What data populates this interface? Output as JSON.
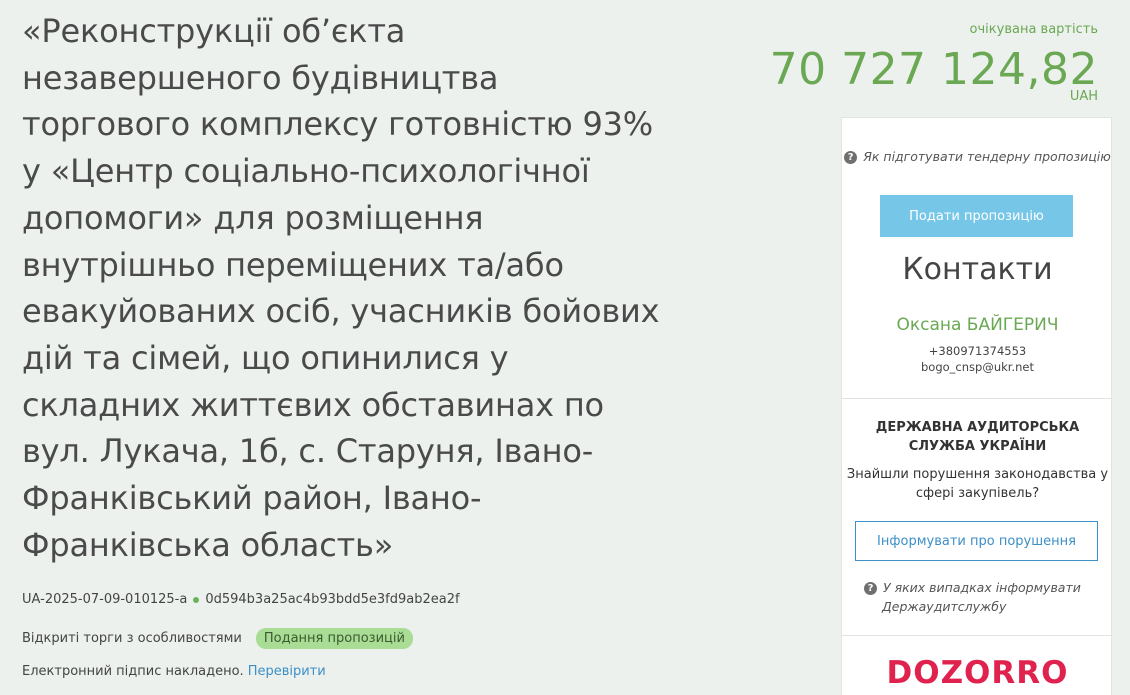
{
  "tender": {
    "title": "«Реконструкції об’єкта незавершеного будівництва торгового комплексу готовністю 93% у «Центр соціально-психологічної допомоги» для розміщення внутрішньо переміщених та/або евакуйованих осіб, учасників бойових дій та сімей, що опинилися у складних життєвих обставинах по вул. Лукача, 1б, с. Старуня, Івано-Франківський район, Івано-Франківська область»",
    "id": "UA-2025-07-09-010125-a",
    "hash": "0d594b3a25ac4b93bdd5e3fd9ab2ea2f",
    "procedure": "Відкриті торги з особливостями",
    "status": "Подання пропозицій",
    "signature_text": "Електронний підпис накладено.",
    "verify_link": "Перевірити"
  },
  "price": {
    "label": "очікувана вартість",
    "amount": "70 727 124,82",
    "currency": "UAH"
  },
  "sidebar": {
    "help_link": "Як підготувати тендерну пропозицію",
    "submit_button": "Подати пропозицію",
    "contacts_title": "Контакти",
    "contact_name": "Оксана БАЙГЕРИЧ",
    "contact_phone": "+380971374553",
    "contact_email": "bogo_cnsp@ukr.net",
    "audit_title": "ДЕРЖАВНА АУДИТОРСЬКА СЛУЖБА УКРАЇНИ",
    "audit_question": "Знайшли порушення законодавства у сфері закупівель?",
    "inform_button": "Інформувати про порушення",
    "audit_help_line1": "У яких випадках інформувати",
    "audit_help_line2": "Держаудитслужбу",
    "logo_text": "DOZORRO"
  },
  "colors": {
    "accent_green": "#6aa853",
    "accent_blue": "#3c8fc7",
    "button_blue": "#76c6e8",
    "status_badge": "#a9dc95",
    "logo_red": "#e0234e",
    "background": "#edf1ee"
  },
  "icons": {
    "help": "question-circle-icon",
    "status_dot": "green-dot-icon"
  }
}
